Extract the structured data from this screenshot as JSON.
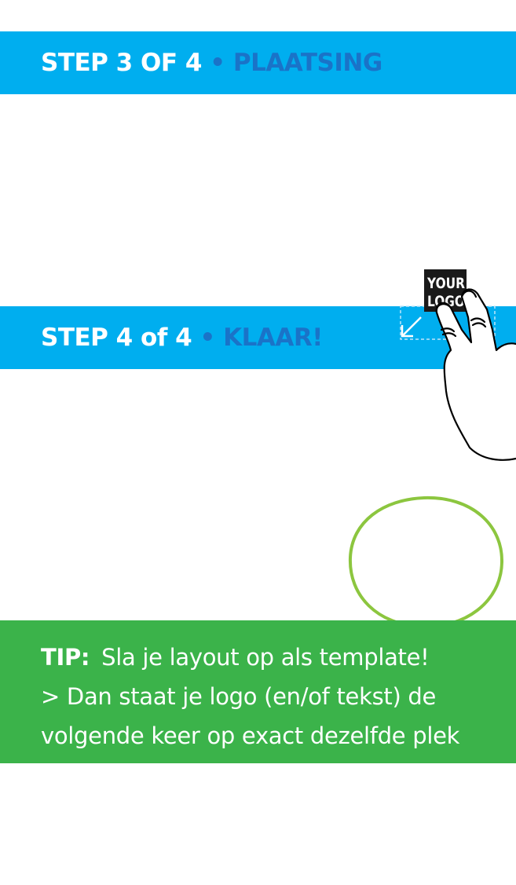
{
  "steps": [
    {
      "prefix": "STEP 3 OF 4",
      "separator": "•",
      "name": "PLAATSING"
    },
    {
      "prefix": "STEP 4 of 4",
      "separator": "•",
      "name": "KLAAR!"
    }
  ],
  "illustration": {
    "logo_line1": "YOUR",
    "logo_line2": "LOGO",
    "icon": "two-finger-resize-hand-icon"
  },
  "tip": {
    "label": "TIP:",
    "line1": "Sla je layout op als template!",
    "line2": "> Dan staat je logo (en/of tekst) de",
    "line3": "volgende keer op exact dezelfde plek"
  },
  "colors": {
    "step_band": "#00aeef",
    "step_accent": "#1a73c8",
    "tip_band": "#3bb34a",
    "highlight_circle": "#8cc63f"
  }
}
